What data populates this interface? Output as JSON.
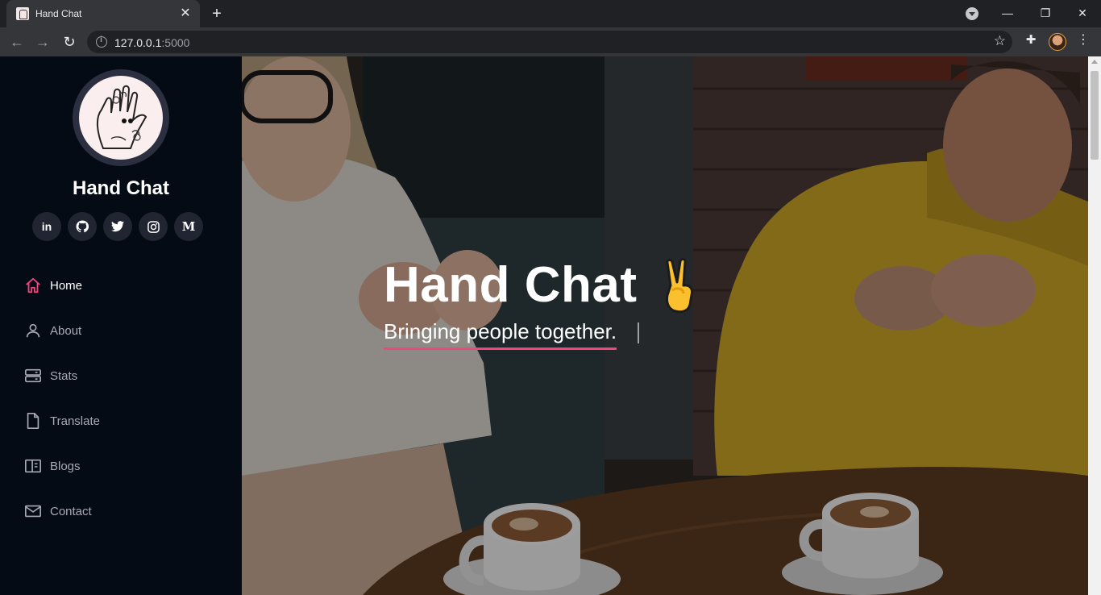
{
  "browser": {
    "tab_title": "Hand Chat",
    "url_host": "127.0.0.1",
    "url_port": ":5000"
  },
  "sidebar": {
    "brand": "Hand Chat",
    "socials": [
      {
        "icon": "linkedin-icon",
        "glyph": "in"
      },
      {
        "icon": "github-icon",
        "glyph": "◉"
      },
      {
        "icon": "twitter-icon",
        "glyph": "🐦"
      },
      {
        "icon": "instagram-icon",
        "glyph": "◎"
      },
      {
        "icon": "medium-icon",
        "glyph": "M"
      }
    ],
    "nav": [
      {
        "label": "Home",
        "icon": "home-icon",
        "active": true
      },
      {
        "label": "About",
        "icon": "user-icon",
        "active": false
      },
      {
        "label": "Stats",
        "icon": "server-icon",
        "active": false
      },
      {
        "label": "Translate",
        "icon": "file-icon",
        "active": false
      },
      {
        "label": "Blogs",
        "icon": "book-icon",
        "active": false
      },
      {
        "label": "Contact",
        "icon": "envelope-icon",
        "active": false
      }
    ]
  },
  "hero": {
    "title": "Hand Chat",
    "subtitle": "Bringing people together.",
    "emoji": "victory-hand-icon"
  },
  "colors": {
    "accent": "#f0457d",
    "sidebar_bg": "#040b14",
    "social_bg": "#212431",
    "nav_text": "#a8a9b4"
  }
}
